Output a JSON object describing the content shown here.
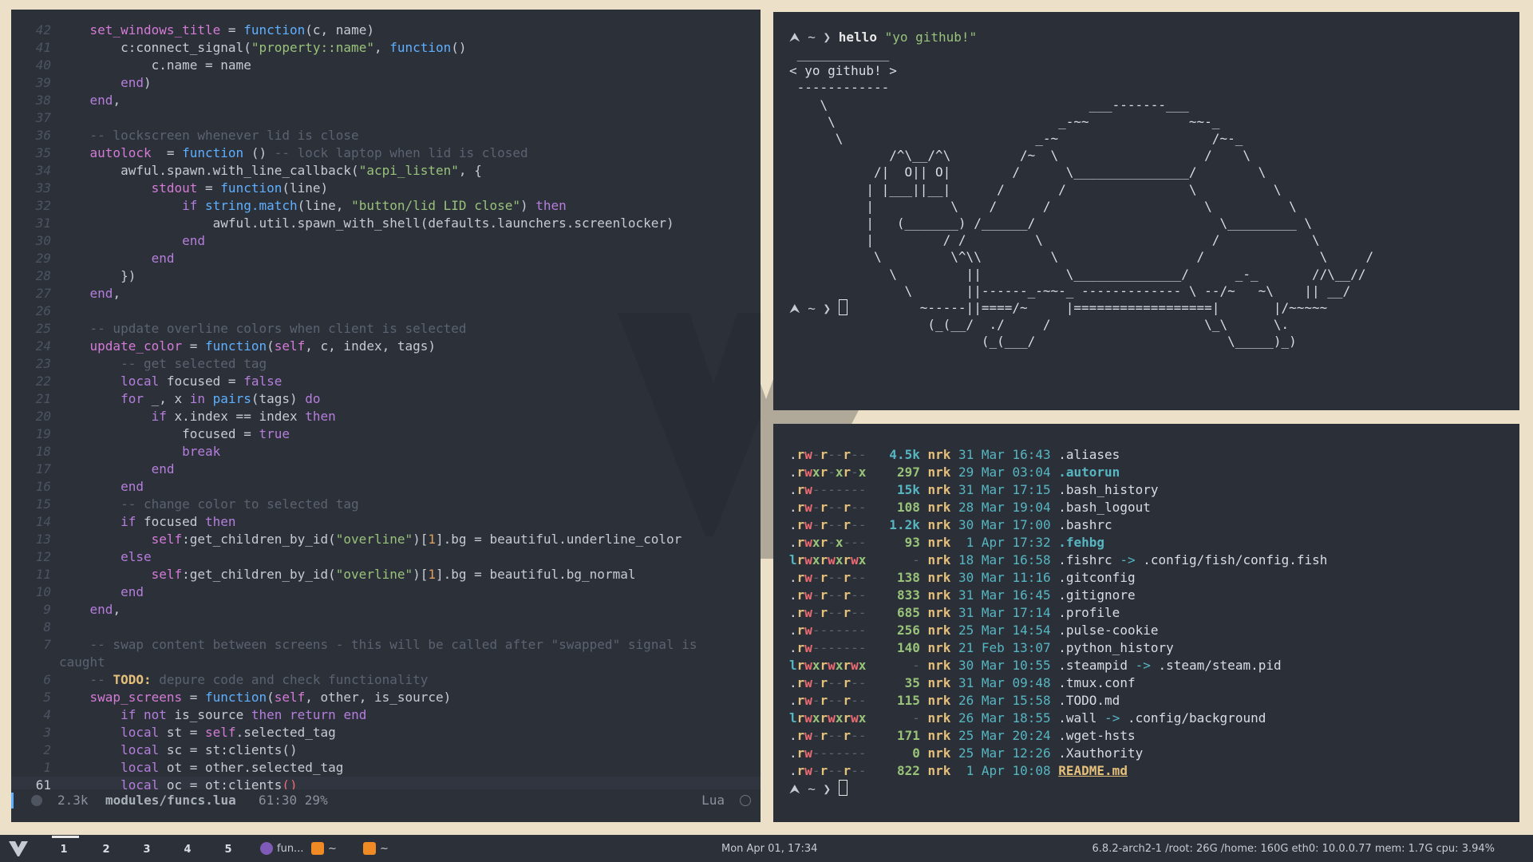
{
  "editor": {
    "lines": [
      {
        "n": "42",
        "t": [
          [
            "    ",
            ""
          ],
          [
            "set_windows_title",
            "vr"
          ],
          [
            " = ",
            ""
          ],
          [
            "function",
            "fn"
          ],
          [
            "(c, name)",
            ""
          ]
        ]
      },
      {
        "n": "41",
        "t": [
          [
            "        c:connect_signal(",
            ""
          ],
          [
            "\"property::name\"",
            "str"
          ],
          [
            ", ",
            ""
          ],
          [
            "function",
            "fn"
          ],
          [
            "()",
            ""
          ]
        ]
      },
      {
        "n": "40",
        "t": [
          [
            "            c.name = name",
            ""
          ]
        ]
      },
      {
        "n": "39",
        "t": [
          [
            "        ",
            ""
          ],
          [
            "end",
            "kw"
          ],
          [
            ")",
            ""
          ]
        ]
      },
      {
        "n": "38",
        "t": [
          [
            "    ",
            ""
          ],
          [
            "end",
            "kw"
          ],
          [
            ",",
            ""
          ]
        ]
      },
      {
        "n": "37",
        "t": [
          [
            "",
            ""
          ]
        ]
      },
      {
        "n": "36",
        "t": [
          [
            "    ",
            ""
          ],
          [
            "-- lockscreen whenever lid is close",
            "cm"
          ]
        ]
      },
      {
        "n": "35",
        "t": [
          [
            "    ",
            ""
          ],
          [
            "autolock",
            "vr"
          ],
          [
            "  = ",
            ""
          ],
          [
            "function",
            "fn"
          ],
          [
            " () ",
            ""
          ],
          [
            "-- lock laptop when lid is closed",
            "cm"
          ]
        ]
      },
      {
        "n": "34",
        "t": [
          [
            "        awful.spawn.with_line_callback(",
            ""
          ],
          [
            "\"acpi_listen\"",
            "str"
          ],
          [
            ", {",
            ""
          ]
        ]
      },
      {
        "n": "33",
        "t": [
          [
            "            ",
            ""
          ],
          [
            "stdout",
            "vr"
          ],
          [
            " = ",
            ""
          ],
          [
            "function",
            "fn"
          ],
          [
            "(line)",
            ""
          ]
        ]
      },
      {
        "n": "32",
        "t": [
          [
            "                ",
            ""
          ],
          [
            "if",
            "kw"
          ],
          [
            " ",
            ""
          ],
          [
            "string.match",
            "fn"
          ],
          [
            "(line, ",
            ""
          ],
          [
            "\"button/lid LID close\"",
            "str"
          ],
          [
            ") ",
            ""
          ],
          [
            "then",
            "kw"
          ]
        ]
      },
      {
        "n": "31",
        "t": [
          [
            "                    awful.util.spawn_with_shell(defaults.launchers.screenlocker)",
            ""
          ]
        ]
      },
      {
        "n": "30",
        "t": [
          [
            "                ",
            ""
          ],
          [
            "end",
            "kw"
          ]
        ]
      },
      {
        "n": "29",
        "t": [
          [
            "            ",
            ""
          ],
          [
            "end",
            "kw"
          ]
        ]
      },
      {
        "n": "28",
        "t": [
          [
            "        })",
            ""
          ]
        ]
      },
      {
        "n": "27",
        "t": [
          [
            "    ",
            ""
          ],
          [
            "end",
            "kw"
          ],
          [
            ",",
            ""
          ]
        ]
      },
      {
        "n": "26",
        "t": [
          [
            "",
            ""
          ]
        ]
      },
      {
        "n": "25",
        "t": [
          [
            "    ",
            ""
          ],
          [
            "-- update overline colors when client is selected",
            "cm"
          ]
        ]
      },
      {
        "n": "24",
        "t": [
          [
            "    ",
            ""
          ],
          [
            "update_color",
            "vr"
          ],
          [
            " = ",
            ""
          ],
          [
            "function",
            "fn"
          ],
          [
            "(",
            ""
          ],
          [
            "self",
            "sf"
          ],
          [
            ", c, index, tags)",
            ""
          ]
        ]
      },
      {
        "n": "23",
        "t": [
          [
            "        ",
            ""
          ],
          [
            "-- get selected tag",
            "cm"
          ]
        ]
      },
      {
        "n": "22",
        "t": [
          [
            "        ",
            ""
          ],
          [
            "local",
            "kw"
          ],
          [
            " focused = ",
            ""
          ],
          [
            "false",
            "kw"
          ]
        ]
      },
      {
        "n": "21",
        "t": [
          [
            "        ",
            ""
          ],
          [
            "for",
            "kw"
          ],
          [
            " _, x ",
            ""
          ],
          [
            "in",
            "kw"
          ],
          [
            " ",
            ""
          ],
          [
            "pairs",
            "fn"
          ],
          [
            "(tags) ",
            ""
          ],
          [
            "do",
            "kw"
          ]
        ]
      },
      {
        "n": "20",
        "t": [
          [
            "            ",
            ""
          ],
          [
            "if",
            "kw"
          ],
          [
            " x.index == index ",
            ""
          ],
          [
            "then",
            "kw"
          ]
        ]
      },
      {
        "n": "19",
        "t": [
          [
            "                focused = ",
            ""
          ],
          [
            "true",
            "kw"
          ]
        ]
      },
      {
        "n": "18",
        "t": [
          [
            "                ",
            ""
          ],
          [
            "break",
            "kw"
          ]
        ]
      },
      {
        "n": "17",
        "t": [
          [
            "            ",
            ""
          ],
          [
            "end",
            "kw"
          ]
        ]
      },
      {
        "n": "16",
        "t": [
          [
            "        ",
            ""
          ],
          [
            "end",
            "kw"
          ]
        ]
      },
      {
        "n": "15",
        "t": [
          [
            "        ",
            ""
          ],
          [
            "-- change color to selected tag",
            "cm"
          ]
        ]
      },
      {
        "n": "14",
        "t": [
          [
            "        ",
            ""
          ],
          [
            "if",
            "kw"
          ],
          [
            " focused ",
            ""
          ],
          [
            "then",
            "kw"
          ]
        ]
      },
      {
        "n": "13",
        "t": [
          [
            "            ",
            ""
          ],
          [
            "self",
            "sf"
          ],
          [
            ":get_children_by_id(",
            ""
          ],
          [
            "\"overline\"",
            "str"
          ],
          [
            ")[",
            ""
          ],
          [
            "1",
            "num"
          ],
          [
            "].bg = beautiful.underline_color",
            ""
          ]
        ]
      },
      {
        "n": "12",
        "t": [
          [
            "        ",
            ""
          ],
          [
            "else",
            "kw"
          ]
        ]
      },
      {
        "n": "11",
        "t": [
          [
            "            ",
            ""
          ],
          [
            "self",
            "sf"
          ],
          [
            ":get_children_by_id(",
            ""
          ],
          [
            "\"overline\"",
            "str"
          ],
          [
            ")[",
            ""
          ],
          [
            "1",
            "num"
          ],
          [
            "].bg = beautiful.bg_normal",
            ""
          ]
        ]
      },
      {
        "n": "10",
        "t": [
          [
            "        ",
            ""
          ],
          [
            "end",
            "kw"
          ]
        ]
      },
      {
        "n": "9",
        "t": [
          [
            "    ",
            ""
          ],
          [
            "end",
            "kw"
          ],
          [
            ",",
            ""
          ]
        ]
      },
      {
        "n": "8",
        "t": [
          [
            "",
            ""
          ]
        ]
      },
      {
        "n": "7",
        "t": [
          [
            "    ",
            ""
          ],
          [
            "-- swap content between screens - this will be called after \"swapped\" signal is",
            "cm"
          ]
        ]
      },
      {
        "n": "",
        "wrap": true,
        "t": [
          [
            "caught",
            "cm"
          ]
        ]
      },
      {
        "n": "6",
        "t": [
          [
            "    ",
            ""
          ],
          [
            "-- ",
            "cm"
          ],
          [
            "TODO:",
            "todo"
          ],
          [
            " depure code and check functionality",
            "cm"
          ]
        ]
      },
      {
        "n": "5",
        "t": [
          [
            "    ",
            ""
          ],
          [
            "swap_screens",
            "vr"
          ],
          [
            " = ",
            ""
          ],
          [
            "function",
            "fn"
          ],
          [
            "(",
            ""
          ],
          [
            "self",
            "sf"
          ],
          [
            ", other, is_source)",
            ""
          ]
        ]
      },
      {
        "n": "4",
        "t": [
          [
            "        ",
            ""
          ],
          [
            "if",
            "kw"
          ],
          [
            " ",
            ""
          ],
          [
            "not",
            "kw"
          ],
          [
            " is_source ",
            ""
          ],
          [
            "then",
            "kw"
          ],
          [
            " ",
            ""
          ],
          [
            "return",
            "kw"
          ],
          [
            " ",
            ""
          ],
          [
            "end",
            "kw"
          ]
        ]
      },
      {
        "n": "3",
        "t": [
          [
            "        ",
            ""
          ],
          [
            "local",
            "kw"
          ],
          [
            " st = ",
            ""
          ],
          [
            "self",
            "sf"
          ],
          [
            ".selected_tag",
            ""
          ]
        ]
      },
      {
        "n": "2",
        "t": [
          [
            "        ",
            ""
          ],
          [
            "local",
            "kw"
          ],
          [
            " sc = st:clients()",
            ""
          ]
        ]
      },
      {
        "n": "1",
        "t": [
          [
            "        ",
            ""
          ],
          [
            "local",
            "kw"
          ],
          [
            " ot = other.selected_tag",
            ""
          ]
        ]
      },
      {
        "n": "61",
        "cur": true,
        "t": [
          [
            "        ",
            ""
          ],
          [
            "local",
            "kw"
          ],
          [
            " oc = ot:clients",
            ""
          ],
          [
            "()",
            "red"
          ]
        ]
      }
    ],
    "status": {
      "size": "2.3k",
      "file": "modules/funcs.lua",
      "position": "61:30 29%",
      "language": "Lua"
    }
  },
  "term_top": {
    "prompt_symbol": "⮝ ~ ❯",
    "command": "hello",
    "command_arg": "\"yo github!\"",
    "cowsay": " ____________\n< yo github! >\n ------------\n    \\                                  ___-------___\n     \\                             _-~~             ~~-_\n      \\                         _-~                    /~-_\n             /^\\__/^\\         /~  \\                   /    \\\n           /|  O|| O|        /      \\_______________/        \\\n          | |___||__|      /       /                \\          \\\n          |          \\    /      /                    \\          \\\n          |   (_______) /______/                        \\_________ \\\n          |         / /         \\                      /            \\\n           \\         \\^\\\\         \\                  /               \\     /\n             \\         ||           \\______________/      _-_       //\\__//\n               \\       ||------_-~~-_ ------------- \\ --/~   ~\\    || __/\n                 ~-----||====/~     |==================|       |/~~~~~\n                  (_(__/  ./     /                    \\_\\      \\.\n                         (_(___/                         \\_____)_)"
  },
  "term_bot": {
    "files": [
      {
        "perm": ".rw-r--r--",
        "size": "4.5k",
        "user": "nrk",
        "date": "31 Mar 16:43",
        "name": ".aliases",
        "kind": "plain"
      },
      {
        "perm": ".rwxr-xr-x",
        "size": "297",
        "user": "nrk",
        "date": "29 Mar 03:04",
        "name": ".autorun",
        "kind": "exe"
      },
      {
        "perm": ".rw-------",
        "size": "15k",
        "user": "nrk",
        "date": "31 Mar 17:15",
        "name": ".bash_history",
        "kind": "plain"
      },
      {
        "perm": ".rw-r--r--",
        "size": "108",
        "user": "nrk",
        "date": "28 Mar 19:04",
        "name": ".bash_logout",
        "kind": "plain"
      },
      {
        "perm": ".rw-r--r--",
        "size": "1.2k",
        "user": "nrk",
        "date": "30 Mar 17:00",
        "name": ".bashrc",
        "kind": "plain"
      },
      {
        "perm": ".rwxr-x---",
        "size": "93",
        "user": "nrk",
        "date": " 1 Apr 17:32",
        "name": ".fehbg",
        "kind": "exe"
      },
      {
        "perm": "lrwxrwxrwx",
        "size": "-",
        "user": "nrk",
        "date": "18 Mar 16:58",
        "name": ".fishrc",
        "kind": "link",
        "target": ".config/fish/config.fish"
      },
      {
        "perm": ".rw-r--r--",
        "size": "138",
        "user": "nrk",
        "date": "30 Mar 11:16",
        "name": ".gitconfig",
        "kind": "plain"
      },
      {
        "perm": ".rw-r--r--",
        "size": "833",
        "user": "nrk",
        "date": "31 Mar 16:45",
        "name": ".gitignore",
        "kind": "plain"
      },
      {
        "perm": ".rw-r--r--",
        "size": "685",
        "user": "nrk",
        "date": "31 Mar 17:14",
        "name": ".profile",
        "kind": "plain"
      },
      {
        "perm": ".rw-------",
        "size": "256",
        "user": "nrk",
        "date": "25 Mar 14:54",
        "name": ".pulse-cookie",
        "kind": "plain"
      },
      {
        "perm": ".rw-------",
        "size": "140",
        "user": "nrk",
        "date": "21 Feb 13:07",
        "name": ".python_history",
        "kind": "plain"
      },
      {
        "perm": "lrwxrwxrwx",
        "size": "-",
        "user": "nrk",
        "date": "30 Mar 10:55",
        "name": ".steampid",
        "kind": "link",
        "target": ".steam/steam.pid"
      },
      {
        "perm": ".rw-r--r--",
        "size": "35",
        "user": "nrk",
        "date": "31 Mar 09:48",
        "name": ".tmux.conf",
        "kind": "plain"
      },
      {
        "perm": ".rw-r--r--",
        "size": "115",
        "user": "nrk",
        "date": "26 Mar 15:58",
        "name": ".TODO.md",
        "kind": "plain"
      },
      {
        "perm": "lrwxrwxrwx",
        "size": "-",
        "user": "nrk",
        "date": "26 Mar 18:55",
        "name": ".wall",
        "kind": "link",
        "target": ".config/background"
      },
      {
        "perm": ".rw-r--r--",
        "size": "171",
        "user": "nrk",
        "date": "25 Mar 20:24",
        "name": ".wget-hsts",
        "kind": "plain"
      },
      {
        "perm": ".rw-------",
        "size": "0",
        "user": "nrk",
        "date": "25 Mar 12:26",
        "name": ".Xauthority",
        "kind": "plain"
      },
      {
        "perm": ".rw-r--r--",
        "size": "822",
        "user": "nrk",
        "date": " 1 Apr 10:08",
        "name": "README.md",
        "kind": "readme"
      }
    ],
    "link_arrow": "->"
  },
  "taskbar": {
    "tags": [
      "1",
      "2",
      "3",
      "4",
      "5"
    ],
    "active_tag": 0,
    "tasks": [
      {
        "icon": "emacs-icon",
        "label": "fun..."
      },
      {
        "icon": "terminal-icon",
        "label": "~"
      },
      {
        "icon": "terminal-icon",
        "label": "~"
      }
    ],
    "clock": "Mon Apr 01, 17:34",
    "system": "6.8.2-arch2-1  /root: 26G /home: 160G  eth0: 10.0.0.77  mem: 1.7G  cpu: 3.94%"
  },
  "colors": {
    "background": "#ece1c8",
    "pane": "#2b2f38",
    "accent": "#5eb0ff"
  }
}
